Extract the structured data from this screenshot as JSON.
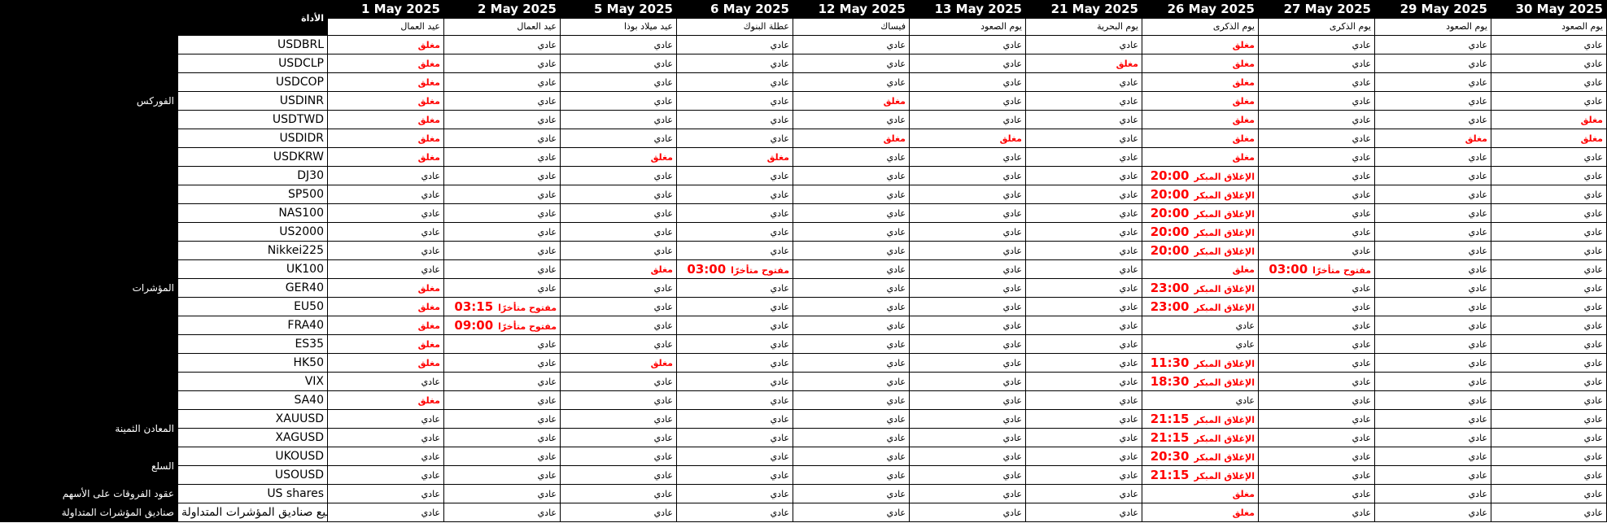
{
  "header": {
    "category_label": "الأداة",
    "dates": [
      "1 May 2025",
      "2 May 2025",
      "5 May 2025",
      "6 May 2025",
      "12 May 2025",
      "13 May 2025",
      "21 May 2025",
      "26 May 2025",
      "27 May 2025",
      "29 May 2025",
      "30 May 2025"
    ],
    "holidays": [
      "عيد العمال",
      "عيد العمال",
      "عيد ميلاد بوذا",
      "عطلة البنوك",
      "فيساك",
      "يوم الصعود",
      "يوم البحرية",
      "يوم الذكرى",
      "يوم الذكرى",
      "يوم الصعود",
      "يوم الصعود"
    ]
  },
  "groups": [
    {
      "name": "الفوركس",
      "rows": [
        {
          "instrument": "USDBRL",
          "cells": [
            "C",
            "N",
            "N",
            "N",
            "N",
            "N",
            "N",
            "C",
            "N",
            "N",
            "N"
          ]
        },
        {
          "instrument": "USDCLP",
          "cells": [
            "C",
            "N",
            "N",
            "N",
            "N",
            "N",
            "C",
            "C",
            "N",
            "N",
            "N"
          ]
        },
        {
          "instrument": "USDCOP",
          "cells": [
            "C",
            "N",
            "N",
            "N",
            "N",
            "N",
            "N",
            "C",
            "N",
            "N",
            "N"
          ]
        },
        {
          "instrument": "USDINR",
          "cells": [
            "C",
            "N",
            "N",
            "N",
            "C",
            "N",
            "N",
            "C",
            "N",
            "N",
            "N"
          ]
        },
        {
          "instrument": "USDTWD",
          "cells": [
            "C",
            "N",
            "N",
            "N",
            "N",
            "N",
            "N",
            "C",
            "N",
            "N",
            "C"
          ]
        },
        {
          "instrument": "USDIDR",
          "cells": [
            "C",
            "N",
            "N",
            "N",
            "C",
            "C",
            "N",
            "C",
            "N",
            "C",
            "C"
          ]
        },
        {
          "instrument": "USDKRW",
          "cells": [
            "C",
            "N",
            "C",
            "C",
            "N",
            "N",
            "N",
            "C",
            "N",
            "N",
            "N"
          ]
        }
      ]
    },
    {
      "name": "المؤشرات",
      "rows": [
        {
          "instrument": "DJ30",
          "cells": [
            "N",
            "N",
            "N",
            "N",
            "N",
            "N",
            "N",
            {
              "t": "20:00",
              "l": "الإغلاق المبكر"
            },
            "N",
            "N",
            "N"
          ]
        },
        {
          "instrument": "SP500",
          "cells": [
            "N",
            "N",
            "N",
            "N",
            "N",
            "N",
            "N",
            {
              "t": "20:00",
              "l": "الإغلاق المبكر"
            },
            "N",
            "N",
            "N"
          ]
        },
        {
          "instrument": "NAS100",
          "cells": [
            "N",
            "N",
            "N",
            "N",
            "N",
            "N",
            "N",
            {
              "t": "20:00",
              "l": "الإغلاق المبكر"
            },
            "N",
            "N",
            "N"
          ]
        },
        {
          "instrument": "US2000",
          "cells": [
            "N",
            "N",
            "N",
            "N",
            "N",
            "N",
            "N",
            {
              "t": "20:00",
              "l": "الإغلاق المبكر"
            },
            "N",
            "N",
            "N"
          ]
        },
        {
          "instrument": "Nikkei225",
          "cells": [
            "N",
            "N",
            "N",
            "N",
            "N",
            "N",
            "N",
            {
              "t": "20:00",
              "l": "الإغلاق المبكر"
            },
            "N",
            "N",
            "N"
          ]
        },
        {
          "instrument": "UK100",
          "cells": [
            "N",
            "N",
            "C",
            {
              "t": "03:00",
              "l": "مفتوح متأخرًا"
            },
            "N",
            "N",
            "N",
            "C",
            {
              "t": "03:00",
              "l": "مفتوح متأخرًا"
            },
            "N",
            "N"
          ]
        },
        {
          "instrument": "GER40",
          "cells": [
            "C",
            "N",
            "N",
            "N",
            "N",
            "N",
            "N",
            {
              "t": "23:00",
              "l": "الإغلاق المبكر"
            },
            "N",
            "N",
            "N"
          ]
        },
        {
          "instrument": "EU50",
          "cells": [
            "C",
            {
              "t": "03:15",
              "l": "مفتوح متأخرًا"
            },
            "N",
            "N",
            "N",
            "N",
            "N",
            {
              "t": "23:00",
              "l": "الإغلاق المبكر"
            },
            "N",
            "N",
            "N"
          ]
        },
        {
          "instrument": "FRA40",
          "cells": [
            "C",
            {
              "t": "09:00",
              "l": "مفتوح متأخرًا"
            },
            "N",
            "N",
            "N",
            "N",
            "N",
            "N",
            "N",
            "N",
            "N"
          ]
        },
        {
          "instrument": "ES35",
          "cells": [
            "C",
            "N",
            "N",
            "N",
            "N",
            "N",
            "N",
            "N",
            "N",
            "N",
            "N"
          ]
        },
        {
          "instrument": "HK50",
          "cells": [
            "C",
            "N",
            "C",
            "N",
            "N",
            "N",
            "N",
            {
              "t": "11:30",
              "l": "الإغلاق المبكر"
            },
            "N",
            "N",
            "N"
          ]
        },
        {
          "instrument": "VIX",
          "cells": [
            "N",
            "N",
            "N",
            "N",
            "N",
            "N",
            "N",
            {
              "t": "18:30",
              "l": "الإغلاق المبكر"
            },
            "N",
            "N",
            "N"
          ]
        },
        {
          "instrument": "SA40",
          "cells": [
            "C",
            "N",
            "N",
            "N",
            "N",
            "N",
            "N",
            "N",
            "N",
            "N",
            "N"
          ]
        }
      ]
    },
    {
      "name": "المعادن الثمينة",
      "rows": [
        {
          "instrument": "XAUUSD",
          "cells": [
            "N",
            "N",
            "N",
            "N",
            "N",
            "N",
            "N",
            {
              "t": "21:15",
              "l": "الإغلاق المبكر"
            },
            "N",
            "N",
            "N"
          ]
        },
        {
          "instrument": "XAGUSD",
          "cells": [
            "N",
            "N",
            "N",
            "N",
            "N",
            "N",
            "N",
            {
              "t": "21:15",
              "l": "الإغلاق المبكر"
            },
            "N",
            "N",
            "N"
          ]
        }
      ]
    },
    {
      "name": "السلع",
      "rows": [
        {
          "instrument": "UKOUSD",
          "cells": [
            "N",
            "N",
            "N",
            "N",
            "N",
            "N",
            "N",
            {
              "t": "20:30",
              "l": "الإغلاق المبكر"
            },
            "N",
            "N",
            "N"
          ]
        },
        {
          "instrument": "USOUSD",
          "cells": [
            "N",
            "N",
            "N",
            "N",
            "N",
            "N",
            "N",
            {
              "t": "21:15",
              "l": "الإغلاق المبكر"
            },
            "N",
            "N",
            "N"
          ]
        }
      ]
    },
    {
      "name": "عقود الفروقات على الأسهم",
      "rows": [
        {
          "instrument": "US shares",
          "cells": [
            "N",
            "N",
            "N",
            "N",
            "N",
            "N",
            "N",
            "C",
            "N",
            "N",
            "N"
          ]
        }
      ]
    },
    {
      "name": "صناديق المؤشرات المتداولة",
      "rows": [
        {
          "instrument": "جميع صناديق المؤشرات المتداولة",
          "cells": [
            "N",
            "N",
            "N",
            "N",
            "N",
            "N",
            "N",
            "C",
            "N",
            "N",
            "N"
          ]
        }
      ]
    }
  ],
  "labels": {
    "normal": "عادي",
    "closed": "مغلق"
  },
  "colors": {
    "closed": "#ff0000",
    "header_bg": "#000000",
    "header_text": "#ffffff"
  }
}
